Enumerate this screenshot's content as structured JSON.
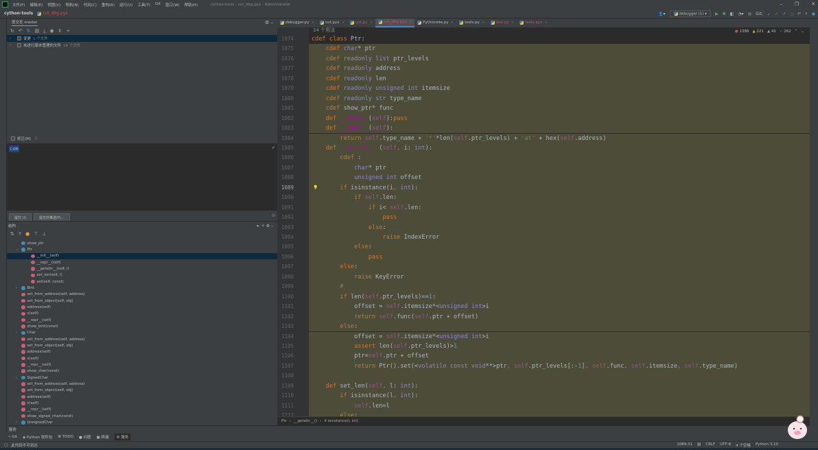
{
  "menu": {
    "items": [
      "文件(F)",
      "编辑(E)",
      "视图(V)",
      "导航(N)",
      "代码(C)",
      "重构(R)",
      "运行(U)",
      "工具(T)",
      "Git",
      "窗口(W)",
      "帮助(H)"
    ],
    "window_title": "cython-tools - cut_dbg.pyx - Administrator"
  },
  "nav": {
    "project": "cython-tools",
    "file": "cut_dbg.pyx"
  },
  "run": {
    "config": "debugger (1)",
    "git_label": "Git:"
  },
  "commit": {
    "tab": "提交至 master",
    "tree": [
      {
        "label": "变更",
        "count": "1 个文件"
      },
      {
        "label": "未进行版本管理的文件",
        "count": "14 个文件"
      }
    ],
    "amend": "修正(M)",
    "message": "com",
    "commit_btn": "提交 (I)",
    "commit_push_btn": "提交并推送(P)..."
  },
  "structure": {
    "title": "结构",
    "items": [
      {
        "label": "show_ptr",
        "icon": "c",
        "level": 1
      },
      {
        "label": "Ptr",
        "icon": "c",
        "level": 1,
        "arrow": "⌄"
      },
      {
        "label": "__init__(self)",
        "icon": "m",
        "level": 2,
        "selected": true
      },
      {
        "label": "__repr__(self)",
        "icon": "m",
        "level": 2
      },
      {
        "label": "__getattr__(self, i)",
        "icon": "m",
        "level": 2
      },
      {
        "label": "set_len(self, l)",
        "icon": "m",
        "level": 2
      },
      {
        "label": "set(self, const)",
        "icon": "m",
        "level": 2
      },
      {
        "label": "Bint",
        "icon": "c",
        "level": 1,
        "arrow": "›"
      },
      {
        "label": "set_from_address(self, address)",
        "icon": "f",
        "level": 1
      },
      {
        "label": "set_from_object(self, obj)",
        "icon": "f",
        "level": 1
      },
      {
        "label": "address(self)",
        "icon": "f",
        "level": 1
      },
      {
        "label": "v(self)",
        "icon": "f",
        "level": 1
      },
      {
        "label": "__repr__(self)",
        "icon": "f",
        "level": 1
      },
      {
        "label": "show_bint(const)",
        "icon": "f",
        "level": 1
      },
      {
        "label": "Char",
        "icon": "c",
        "level": 1,
        "arrow": "›"
      },
      {
        "label": "set_from_address(self, address)",
        "icon": "f",
        "level": 1
      },
      {
        "label": "set_from_object(self, obj)",
        "icon": "f",
        "level": 1
      },
      {
        "label": "address(self)",
        "icon": "f",
        "level": 1
      },
      {
        "label": "v(self)",
        "icon": "f",
        "level": 1
      },
      {
        "label": "__repr__(self)",
        "icon": "f",
        "level": 1
      },
      {
        "label": "show_char(const)",
        "icon": "f",
        "level": 1
      },
      {
        "label": "SignedChar",
        "icon": "c",
        "level": 1,
        "arrow": "›"
      },
      {
        "label": "set_from_address(self, address)",
        "icon": "f",
        "level": 1
      },
      {
        "label": "set_from_object(self, obj)",
        "icon": "f",
        "level": 1
      },
      {
        "label": "address(self)",
        "icon": "f",
        "level": 1
      },
      {
        "label": "v(self)",
        "icon": "f",
        "level": 1
      },
      {
        "label": "__repr__(self)",
        "icon": "f",
        "level": 1
      },
      {
        "label": "show_signed_char(const)",
        "icon": "f",
        "level": 1
      },
      {
        "label": "UnsignedChar",
        "icon": "c",
        "level": 1,
        "arrow": "›"
      }
    ]
  },
  "editor": {
    "tabs": [
      {
        "label": "debugger.py",
        "red": false
      },
      {
        "label": "cut.pyx",
        "red": false
      },
      {
        "label": "cut.py",
        "red": true
      },
      {
        "label": "cut_dbg.pyx",
        "red": true,
        "active": true
      },
      {
        "label": "PyUnicode.py",
        "red": false
      },
      {
        "label": "tools.py",
        "red": false
      },
      {
        "label": "test.py",
        "red": true
      },
      {
        "label": "testc.pyx",
        "red": true
      }
    ],
    "usages": "34 个用法",
    "inspections": {
      "errors": "1386",
      "warnings": "221",
      "weak": "42",
      "ok": "262"
    },
    "first_line": 1074,
    "lines": [
      [
        [
          "k",
          "cdef "
        ],
        [
          "k",
          "class "
        ],
        [
          "p",
          "Ptr:"
        ]
      ],
      [
        [
          "p",
          "    "
        ],
        [
          "k",
          "cdef "
        ],
        [
          "t",
          "char"
        ],
        [
          "p",
          "* ptr"
        ]
      ],
      [
        [
          "p",
          "    "
        ],
        [
          "k",
          "cdef "
        ],
        [
          "t",
          "readonly "
        ],
        [
          "t",
          "list "
        ],
        [
          "p",
          "ptr_levels"
        ]
      ],
      [
        [
          "p",
          "    "
        ],
        [
          "k",
          "cdef "
        ],
        [
          "t",
          "readonly "
        ],
        [
          "p",
          "address"
        ]
      ],
      [
        [
          "p",
          "    "
        ],
        [
          "k",
          "cdef "
        ],
        [
          "t",
          "readonly "
        ],
        [
          "p",
          "len"
        ]
      ],
      [
        [
          "p",
          "    "
        ],
        [
          "k",
          "cdef "
        ],
        [
          "t",
          "readonly unsigned int "
        ],
        [
          "p",
          "itemsize"
        ]
      ],
      [
        [
          "p",
          "    "
        ],
        [
          "k",
          "cdef "
        ],
        [
          "t",
          "readonly "
        ],
        [
          "t",
          "str "
        ],
        [
          "p",
          "type_name"
        ]
      ],
      [
        [
          "p",
          "    "
        ],
        [
          "k",
          "cdef "
        ],
        [
          "p",
          "show_ptr* func"
        ]
      ],
      [
        [
          "p",
          "    "
        ],
        [
          "k",
          "def "
        ],
        [
          "m",
          "__init__"
        ],
        [
          "p",
          "("
        ],
        [
          "s",
          "self"
        ],
        [
          "p",
          "):"
        ],
        [
          "k",
          "pass"
        ]
      ],
      [
        [
          "p",
          "    "
        ],
        [
          "k",
          "def "
        ],
        [
          "m",
          "__repr__"
        ],
        [
          "p",
          "("
        ],
        [
          "s",
          "self"
        ],
        [
          "p",
          "):"
        ]
      ],
      [
        [
          "p",
          "        "
        ],
        [
          "k",
          "return "
        ],
        [
          "s",
          "self"
        ],
        [
          "p",
          ".type_name + "
        ],
        [
          "str",
          "'*'"
        ],
        [
          "p",
          "*len("
        ],
        [
          "s",
          "self"
        ],
        [
          "p",
          ".ptr_levels) + "
        ],
        [
          "str",
          "'at'"
        ],
        [
          "p",
          " + hex("
        ],
        [
          "s",
          "self"
        ],
        [
          "p",
          ".address)"
        ]
      ],
      [
        [
          "p",
          "    "
        ],
        [
          "k",
          "def "
        ],
        [
          "m",
          "__getattr__"
        ],
        [
          "p",
          "("
        ],
        [
          "s",
          "self"
        ],
        [
          "k",
          ", "
        ],
        [
          "p",
          "i: "
        ],
        [
          "t",
          "int"
        ],
        [
          "p",
          "):"
        ]
      ],
      [
        [
          "p",
          "        "
        ],
        [
          "k",
          "cdef "
        ],
        [
          "p",
          ":"
        ]
      ],
      [
        [
          "p",
          "            "
        ],
        [
          "t",
          "char"
        ],
        [
          "p",
          "* ptr"
        ]
      ],
      [
        [
          "p",
          "            "
        ],
        [
          "t",
          "unsigned int "
        ],
        [
          "p",
          "offset"
        ]
      ],
      [
        [
          "p",
          "        "
        ],
        [
          "k",
          "if "
        ],
        [
          "p",
          "isinstance(i"
        ],
        [
          "k",
          ", "
        ],
        [
          "t",
          "int"
        ],
        [
          "p",
          "):"
        ]
      ],
      [
        [
          "p",
          "            "
        ],
        [
          "k",
          "if "
        ],
        [
          "s",
          "self"
        ],
        [
          "p",
          ".len:"
        ]
      ],
      [
        [
          "p",
          "                "
        ],
        [
          "k",
          "if "
        ],
        [
          "p",
          "i< "
        ],
        [
          "s",
          "self"
        ],
        [
          "p",
          ".len:"
        ]
      ],
      [
        [
          "p",
          "                    "
        ],
        [
          "k",
          "pass"
        ]
      ],
      [
        [
          "p",
          "                "
        ],
        [
          "k",
          "else"
        ],
        [
          "p",
          ":"
        ]
      ],
      [
        [
          "p",
          "                    "
        ],
        [
          "k",
          "raise "
        ],
        [
          "p",
          "IndexError"
        ]
      ],
      [
        [
          "p",
          "            "
        ],
        [
          "k",
          "else"
        ],
        [
          "p",
          ":"
        ]
      ],
      [
        [
          "p",
          "                "
        ],
        [
          "k",
          "pass"
        ]
      ],
      [
        [
          "p",
          "        "
        ],
        [
          "k",
          "else"
        ],
        [
          "p",
          ":"
        ]
      ],
      [
        [
          "p",
          "            "
        ],
        [
          "k",
          "raise "
        ],
        [
          "p",
          "KeyError"
        ]
      ],
      [
        [
          "p",
          "        "
        ],
        [
          "cm",
          "#"
        ]
      ],
      [
        [
          "p",
          "        "
        ],
        [
          "k",
          "if "
        ],
        [
          "p",
          "len("
        ],
        [
          "s",
          "self"
        ],
        [
          "p",
          ".ptr_levels)=="
        ],
        [
          "n",
          "1"
        ],
        [
          "p",
          ":"
        ]
      ],
      [
        [
          "p",
          "            offset = "
        ],
        [
          "s",
          "self"
        ],
        [
          "p",
          ".itemsize*<"
        ],
        [
          "t",
          "unsigned int"
        ],
        [
          "p",
          ">i"
        ]
      ],
      [
        [
          "p",
          "            "
        ],
        [
          "k",
          "return "
        ],
        [
          "s",
          "self"
        ],
        [
          "p",
          ".func("
        ],
        [
          "s",
          "self"
        ],
        [
          "p",
          ".ptr + offset)"
        ]
      ],
      [
        [
          "p",
          "        "
        ],
        [
          "k",
          "else"
        ],
        [
          "p",
          ":"
        ]
      ],
      [
        [
          "p",
          "            offset = "
        ],
        [
          "s",
          "self"
        ],
        [
          "p",
          ".itemsize*<"
        ],
        [
          "t",
          "unsigned int"
        ],
        [
          "p",
          ">i"
        ]
      ],
      [
        [
          "p",
          "            "
        ],
        [
          "k",
          "assert "
        ],
        [
          "p",
          "len("
        ],
        [
          "s",
          "self"
        ],
        [
          "p",
          ".ptr_levels)>"
        ],
        [
          "n",
          "1"
        ]
      ],
      [
        [
          "p",
          "            ptr="
        ],
        [
          "s",
          "self"
        ],
        [
          "p",
          ".ptr + offset"
        ]
      ],
      [
        [
          "p",
          "            "
        ],
        [
          "k",
          "return "
        ],
        [
          "p",
          "Ptr().set(<"
        ],
        [
          "t",
          "volatile const void"
        ],
        [
          "p",
          "**>ptr"
        ],
        [
          "k",
          ", "
        ],
        [
          "s",
          "self"
        ],
        [
          "p",
          ".ptr_levels[:-"
        ],
        [
          "n",
          "1"
        ],
        [
          "p",
          "]"
        ],
        [
          "k",
          ", "
        ],
        [
          "s",
          "self"
        ],
        [
          "p",
          ".func"
        ],
        [
          "k",
          ", "
        ],
        [
          "s",
          "self"
        ],
        [
          "p",
          ".itemsize"
        ],
        [
          "k",
          ", "
        ],
        [
          "s",
          "self"
        ],
        [
          "p",
          ".type_name)"
        ]
      ],
      [],
      [
        [
          "p",
          "    "
        ],
        [
          "k",
          "def "
        ],
        [
          "p",
          "set_len("
        ],
        [
          "s",
          "self"
        ],
        [
          "k",
          ", "
        ],
        [
          "p",
          "l: "
        ],
        [
          "t",
          "int"
        ],
        [
          "p",
          "):"
        ]
      ],
      [
        [
          "p",
          "        "
        ],
        [
          "k",
          "if "
        ],
        [
          "p",
          "isinstance(l"
        ],
        [
          "k",
          ", "
        ],
        [
          "t",
          "int"
        ],
        [
          "p",
          "):"
        ]
      ],
      [
        [
          "p",
          "            "
        ],
        [
          "s",
          "self"
        ],
        [
          "p",
          ".len=l"
        ]
      ],
      [
        [
          "p",
          "        "
        ],
        [
          "k",
          "else"
        ],
        [
          "p",
          ":"
        ]
      ]
    ],
    "breadcrumb": [
      "Ptr",
      "__getattr__()",
      "if isinstance(i, int)"
    ]
  },
  "bottom": {
    "services": "服务",
    "tool_tabs": [
      "Git",
      "Python 软件包",
      "TODO",
      "问题",
      "终端",
      "服务"
    ],
    "status_msg": "此代码不可到达",
    "position": "1089:31",
    "line_sep": "CRLF",
    "encoding": "UTF-8",
    "indent": "4 个空格",
    "interpreter": "Python 3.10"
  }
}
